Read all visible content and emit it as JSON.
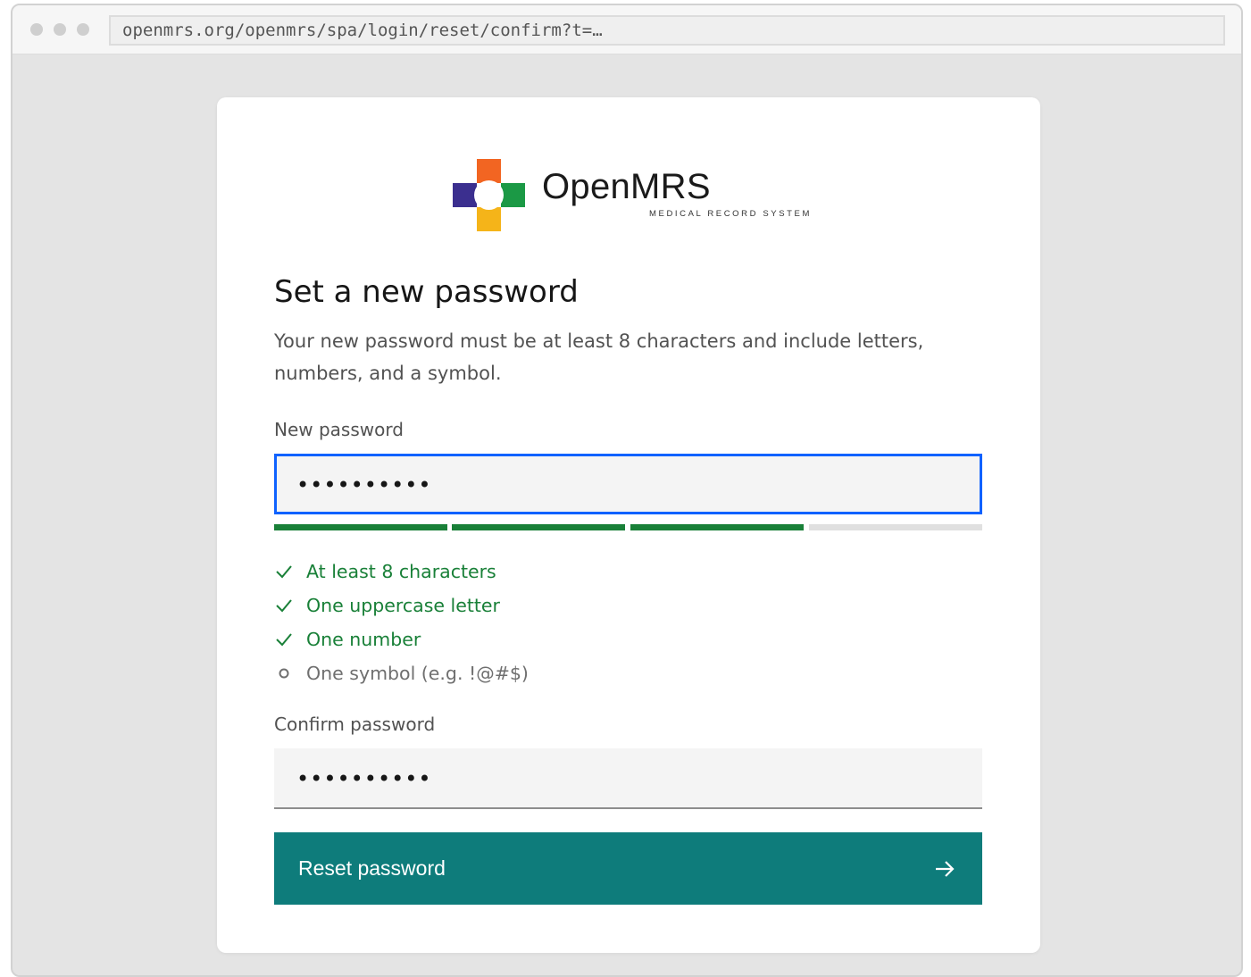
{
  "browser": {
    "url": "openmrs.org/openmrs/spa/login/reset/confirm?t=…"
  },
  "logo": {
    "name": "OpenMRS",
    "tagline": "MEDICAL RECORD SYSTEM",
    "colors": {
      "top": "#f26522",
      "left": "#3b2f8f",
      "right": "#1b9945",
      "bottom": "#f5b419"
    }
  },
  "form": {
    "title": "Set a new password",
    "description": "Your new password must be at least 8 characters and include letters, numbers, and a symbol.",
    "new_password": {
      "label": "New password",
      "value": "••••••••••",
      "strength_segments_filled": 3,
      "strength_segments_total": 4
    },
    "requirements": [
      {
        "label": "At least 8 characters",
        "met": true
      },
      {
        "label": "One uppercase letter",
        "met": true
      },
      {
        "label": "One number",
        "met": true
      },
      {
        "label": "One symbol (e.g. !@#$)",
        "met": false
      }
    ],
    "confirm_password": {
      "label": "Confirm password",
      "value": "••••••••••"
    },
    "submit_label": "Reset password"
  },
  "colors": {
    "accent": "#0e7c7b",
    "focus": "#0f62fe",
    "success": "#198038",
    "muted": "#6f6f6f"
  }
}
